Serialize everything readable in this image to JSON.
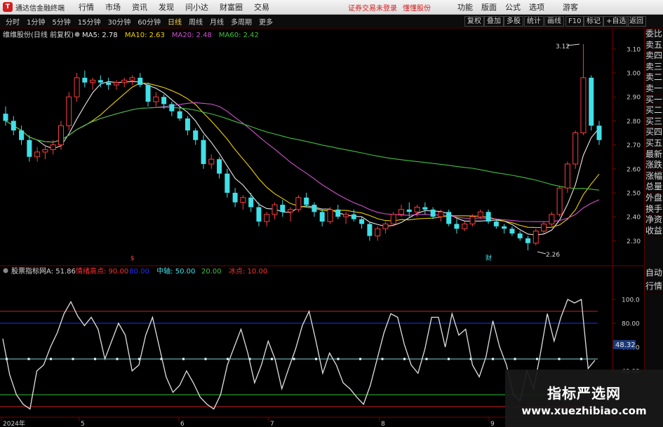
{
  "menubar": {
    "app_title": "通达信金融终端",
    "menus": [
      "行情",
      "市场",
      "资讯",
      "发现",
      "问小达",
      "财富圈",
      "交易"
    ],
    "warning": "证券交易未登录",
    "warning2": "懂懂股份",
    "right_menus": [
      "功能",
      "版面",
      "公式",
      "选项"
    ],
    "guest": "游客"
  },
  "toolbar": {
    "periods": [
      "分时",
      "1分钟",
      "5分钟",
      "15分钟",
      "30分钟",
      "60分钟",
      "日线",
      "周线",
      "月线",
      "多周期",
      "更多"
    ],
    "active_period": "日线",
    "tools": [
      "复权",
      "叠加",
      "多股",
      "统计",
      "画线",
      "F10",
      "标记",
      "+自选",
      "返回"
    ]
  },
  "price_chart": {
    "stock_title": "维维股份(日线 前复权)",
    "ma_legend": [
      {
        "label": "MA5: 2.78",
        "color": "#e8e8e8"
      },
      {
        "label": "MA10: 2.63",
        "color": "#f0d000"
      },
      {
        "label": "MA20: 2.48",
        "color": "#d050d0"
      },
      {
        "label": "MA60: 2.42",
        "color": "#40c040"
      }
    ],
    "y_ticks": [
      "3.10",
      "3.00",
      "2.90",
      "2.80",
      "2.70",
      "2.60",
      "2.50",
      "2.40",
      "2.30"
    ],
    "high_label": "3.12",
    "low_label": "2.26",
    "event_markers": [
      "$",
      "财"
    ],
    "up_color": "#ff3c3c",
    "down_color": "#40e0e8"
  },
  "chart_data": {
    "type": "candlestick",
    "ylim": [
      2.26,
      3.12
    ],
    "ohlc": [
      [
        2.83,
        2.86,
        2.78,
        2.8
      ],
      [
        2.8,
        2.82,
        2.74,
        2.76
      ],
      [
        2.76,
        2.78,
        2.7,
        2.72
      ],
      [
        2.72,
        2.74,
        2.63,
        2.65
      ],
      [
        2.65,
        2.69,
        2.63,
        2.67
      ],
      [
        2.67,
        2.7,
        2.64,
        2.68
      ],
      [
        2.68,
        2.72,
        2.66,
        2.7
      ],
      [
        2.7,
        2.8,
        2.68,
        2.78
      ],
      [
        2.78,
        2.92,
        2.76,
        2.9
      ],
      [
        2.9,
        3.0,
        2.88,
        2.98
      ],
      [
        2.98,
        3.01,
        2.94,
        2.96
      ],
      [
        2.96,
        2.98,
        2.93,
        2.97
      ],
      [
        2.97,
        2.99,
        2.94,
        2.96
      ],
      [
        2.96,
        2.98,
        2.93,
        2.95
      ],
      [
        2.95,
        2.97,
        2.93,
        2.96
      ],
      [
        2.96,
        2.98,
        2.94,
        2.97
      ],
      [
        2.97,
        2.99,
        2.95,
        2.98
      ],
      [
        2.98,
        3.0,
        2.94,
        2.95
      ],
      [
        2.95,
        2.96,
        2.86,
        2.88
      ],
      [
        2.88,
        2.92,
        2.86,
        2.9
      ],
      [
        2.9,
        2.91,
        2.85,
        2.87
      ],
      [
        2.87,
        2.88,
        2.82,
        2.84
      ],
      [
        2.84,
        2.86,
        2.8,
        2.81
      ],
      [
        2.81,
        2.82,
        2.74,
        2.76
      ],
      [
        2.76,
        2.77,
        2.7,
        2.72
      ],
      [
        2.72,
        2.74,
        2.6,
        2.62
      ],
      [
        2.62,
        2.66,
        2.6,
        2.64
      ],
      [
        2.64,
        2.65,
        2.56,
        2.58
      ],
      [
        2.58,
        2.6,
        2.48,
        2.5
      ],
      [
        2.5,
        2.52,
        2.44,
        2.46
      ],
      [
        2.46,
        2.49,
        2.43,
        2.48
      ],
      [
        2.48,
        2.5,
        2.42,
        2.44
      ],
      [
        2.44,
        2.46,
        2.36,
        2.38
      ],
      [
        2.38,
        2.42,
        2.36,
        2.41
      ],
      [
        2.41,
        2.46,
        2.39,
        2.45
      ],
      [
        2.45,
        2.47,
        2.4,
        2.42
      ],
      [
        2.42,
        2.44,
        2.38,
        2.43
      ],
      [
        2.43,
        2.49,
        2.42,
        2.48
      ],
      [
        2.48,
        2.5,
        2.44,
        2.45
      ],
      [
        2.45,
        2.46,
        2.4,
        2.42
      ],
      [
        2.42,
        2.43,
        2.36,
        2.38
      ],
      [
        2.38,
        2.44,
        2.37,
        2.43
      ],
      [
        2.43,
        2.45,
        2.39,
        2.4
      ],
      [
        2.4,
        2.42,
        2.37,
        2.41
      ],
      [
        2.41,
        2.43,
        2.38,
        2.39
      ],
      [
        2.39,
        2.4,
        2.35,
        2.37
      ],
      [
        2.37,
        2.38,
        2.3,
        2.32
      ],
      [
        2.32,
        2.36,
        2.3,
        2.35
      ],
      [
        2.35,
        2.38,
        2.33,
        2.37
      ],
      [
        2.37,
        2.42,
        2.36,
        2.41
      ],
      [
        2.41,
        2.45,
        2.4,
        2.43
      ],
      [
        2.43,
        2.46,
        2.4,
        2.42
      ],
      [
        2.42,
        2.45,
        2.4,
        2.44
      ],
      [
        2.44,
        2.46,
        2.41,
        2.43
      ],
      [
        2.43,
        2.44,
        2.39,
        2.4
      ],
      [
        2.4,
        2.43,
        2.38,
        2.42
      ],
      [
        2.42,
        2.43,
        2.36,
        2.37
      ],
      [
        2.37,
        2.39,
        2.33,
        2.35
      ],
      [
        2.35,
        2.38,
        2.34,
        2.37
      ],
      [
        2.37,
        2.41,
        2.36,
        2.4
      ],
      [
        2.4,
        2.43,
        2.39,
        2.42
      ],
      [
        2.42,
        2.43,
        2.37,
        2.38
      ],
      [
        2.38,
        2.39,
        2.35,
        2.36
      ],
      [
        2.36,
        2.37,
        2.33,
        2.35
      ],
      [
        2.35,
        2.36,
        2.32,
        2.33
      ],
      [
        2.33,
        2.34,
        2.3,
        2.31
      ],
      [
        2.31,
        2.32,
        2.26,
        2.29
      ],
      [
        2.29,
        2.35,
        2.28,
        2.34
      ],
      [
        2.34,
        2.38,
        2.33,
        2.37
      ],
      [
        2.37,
        2.42,
        2.36,
        2.41
      ],
      [
        2.41,
        2.53,
        2.4,
        2.52
      ],
      [
        2.52,
        2.63,
        2.5,
        2.62
      ],
      [
        2.62,
        2.76,
        2.6,
        2.75
      ],
      [
        2.75,
        3.12,
        2.74,
        2.98
      ],
      [
        2.98,
        2.99,
        2.76,
        2.78
      ],
      [
        2.78,
        2.8,
        2.7,
        2.72
      ]
    ]
  },
  "indicator": {
    "title": "股票指标网",
    "value_label": "A: 51.86",
    "legend": [
      {
        "label": "情绪高点: 90.00",
        "color": "#ff3030"
      },
      {
        "label": "80.00",
        "color": "#2030ff"
      },
      {
        "label": "中轴: 50.00",
        "color": "#40e0e8"
      },
      {
        "label": "20.00",
        "color": "#40c040"
      },
      {
        "label": "冰点: 10.00",
        "color": "#ff3030"
      }
    ],
    "y_ticks": [
      "100.0",
      "80.00",
      "60.00",
      "40.00"
    ],
    "current_value": "48.32",
    "levels": {
      "high": 90,
      "upper": 80,
      "mid": 50,
      "lower": 20,
      "freeze": 10
    },
    "values": [
      67,
      37,
      20,
      12,
      8,
      40,
      45,
      60,
      72,
      88,
      98,
      86,
      78,
      85,
      75,
      50,
      65,
      80,
      70,
      40,
      45,
      70,
      85,
      60,
      35,
      22,
      28,
      40,
      30,
      18,
      12,
      8,
      20,
      45,
      60,
      75,
      55,
      30,
      45,
      65,
      50,
      25,
      42,
      58,
      78,
      90,
      65,
      38,
      55,
      45,
      30,
      25,
      18,
      12,
      28,
      50,
      72,
      88,
      85,
      62,
      45,
      38,
      58,
      85,
      85,
      60,
      88,
      70,
      75,
      45,
      35,
      52,
      82,
      60,
      45,
      20,
      15,
      40,
      25,
      55,
      88,
      65,
      85,
      100,
      97,
      100,
      42,
      49
    ]
  },
  "x_axis": {
    "labels": [
      "2024年",
      "5",
      "6",
      "7",
      "8",
      "9"
    ]
  },
  "right_panel": {
    "price_items": [
      "委比",
      "卖五",
      "卖四",
      "卖三",
      "卖二",
      "卖一",
      "买一",
      "买二",
      "买三",
      "买四",
      "买五",
      "最新",
      "涨跌",
      "涨幅",
      "总量",
      "外盘",
      "换手",
      "净资",
      "收益"
    ],
    "indicator_items": [
      "自动",
      "行情"
    ]
  },
  "watermark": {
    "title": "指标严选网",
    "url": "www.xuezhibiao.com"
  }
}
